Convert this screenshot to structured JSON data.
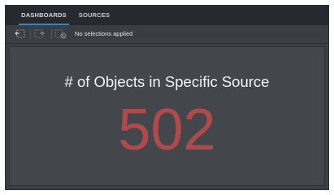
{
  "tabs": {
    "dashboards_label": "DASHBOARDS",
    "sources_label": "SOURCES"
  },
  "toolbar": {
    "selection_status": "No selections applied",
    "icons": [
      "selection-back-icon",
      "selection-forward-icon",
      "clear-selections-icon"
    ]
  },
  "kpi": {
    "title": "# of Objects in Specific Source",
    "value": "502"
  },
  "colors": {
    "tab_active_underline": "#2f86c9",
    "kpi_value": "#b04a4a",
    "background": "#3b3f44"
  }
}
